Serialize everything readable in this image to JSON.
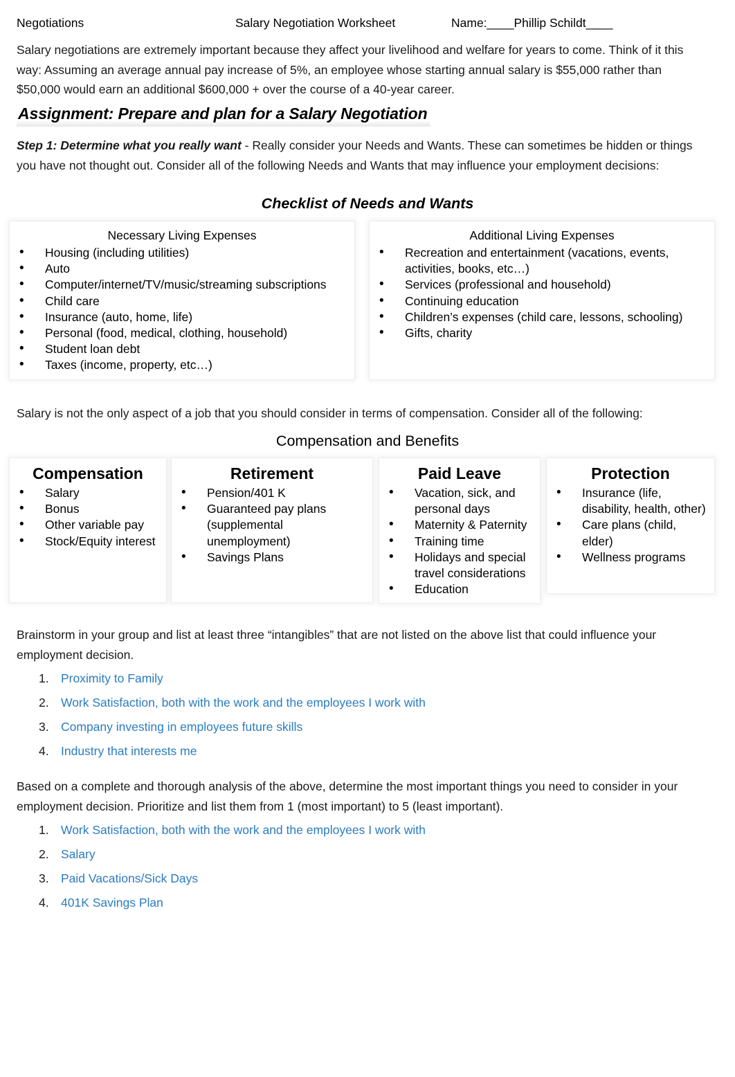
{
  "document": {
    "header": {
      "course": "Negotiations",
      "title": "Salary Negotiation Worksheet",
      "name_field": "Name:____Phillip Schildt____"
    },
    "intro_paragraph": "Salary negotiations are extremely important because they affect your livelihood and welfare for years to come.  Think of it this way:  Assuming an average annual pay increase of 5%, an employee whose starting annual salary is $55,000 rather than $50,000 would earn an additional $600,000 + over the course of a 40-year career.",
    "assignment_heading": "Assignment:  Prepare and plan for a Salary Negotiation",
    "step1": {
      "label": "Step 1:  Determine what you really want",
      "text": " - Really consider your Needs and Wants.  These can sometimes be hidden or things you have not thought out.  Consider all of the following Needs and Wants that may influence your employment decisions:"
    },
    "checklist_heading": "Checklist of Needs and Wants",
    "checklist_table": {
      "columns": [
        {
          "title": "Necessary Living Expenses",
          "items": [
            "Housing (including utilities)",
            "Auto",
            "Computer/internet/TV/music/streaming subscriptions",
            "Child care",
            "Insurance (auto, home, life)",
            "Personal (food, medical, clothing, household)",
            "Student loan debt",
            "Taxes (income, property, etc…)"
          ]
        },
        {
          "title": "Additional Living Expenses",
          "items": [
            "Recreation and entertainment (vacations, events, activities, books, etc…)",
            "Services (professional and household)",
            "Continuing education",
            "Children’s expenses (child care, lessons, schooling)",
            "Gifts, charity"
          ]
        }
      ]
    },
    "compensation_intro": "Salary is not the only aspect of a job that you should consider in terms of compensation.  Consider all of the following:",
    "compensation_heading": "Compensation and Benefits",
    "compensation_table": {
      "columns": [
        {
          "title": "Compensation",
          "items": [
            "Salary",
            "Bonus",
            "Other variable pay",
            "Stock/Equity interest"
          ]
        },
        {
          "title": "Retirement",
          "items": [
            "Pension/401 K",
            "Guaranteed pay plans (supplemental unemployment)",
            "Savings Plans"
          ]
        },
        {
          "title": "Paid Leave",
          "items": [
            "Vacation, sick, and personal days",
            "Maternity & Paternity",
            "Training time",
            "Holidays and special travel considerations",
            "Education"
          ]
        },
        {
          "title": "Protection",
          "items": [
            "Insurance (life, disability, health, other)",
            "Care plans (child, elder)",
            "Wellness programs"
          ]
        }
      ]
    },
    "brainstorm_prompt": "Brainstorm in your group and list at least three “intangibles” that are not listed on the above list that could influence your employment decision.",
    "intangibles_answers": [
      {
        "num": "1.",
        "text": "Proximity to Family"
      },
      {
        "num": "2.",
        "text": " Work Satisfaction, both with the work and the employees I work with"
      },
      {
        "num": "3.",
        "text": " Company investing in employees future skills"
      },
      {
        "num": "4.",
        "text": "Industry that interests me"
      }
    ],
    "priority_prompt": "Based on a complete and thorough analysis of the above, determine the most important things you need to consider in your employment decision.  Prioritize and list them from 1 (most important) to 5 (least important).",
    "priority_answers": [
      {
        "num": "1.",
        "text": " Work Satisfaction, both with the work and the employees I work with"
      },
      {
        "num": "2.",
        "text": " Salary"
      },
      {
        "num": "3.",
        "text": "Paid Vacations/Sick Days"
      },
      {
        "num": "4.",
        "text": "401K Savings Plan"
      }
    ],
    "colors": {
      "answer_blue": "#2b7cc0",
      "body_text": "#1a1a1a",
      "page_background": "#ffffff"
    }
  }
}
